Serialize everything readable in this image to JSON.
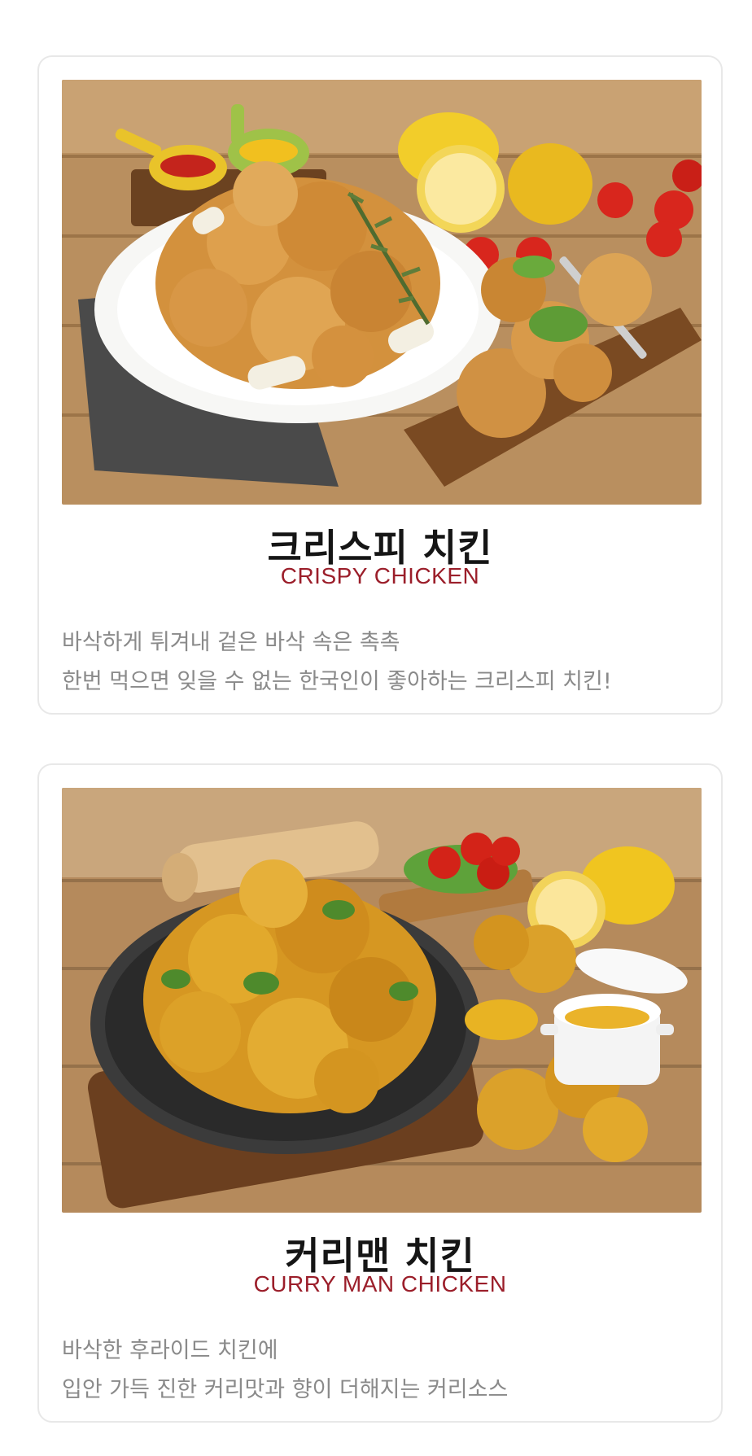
{
  "menu_items": [
    {
      "name_ko": "크리스피 치킨",
      "name_en": "CRISPY CHICKEN",
      "desc_line1": "바삭하게 튀겨내 겉은 바삭 속은 촉촉",
      "desc_line2": "한번 먹으면 잊을 수 없는 한국인이 좋아하는 크리스피 치킨!"
    },
    {
      "name_ko": "커리맨 치킨",
      "name_en": "CURRY MAN CHICKEN",
      "desc_line1": "바삭한 후라이드 치킨에",
      "desc_line2": "입안 가득 진한 커리맛과 향이 더해지는 커리소스"
    }
  ],
  "colors": {
    "title": "#151515",
    "subtitle": "#9b1e2a",
    "description": "#8a8a8a",
    "card_border": "#e8e8e8"
  }
}
